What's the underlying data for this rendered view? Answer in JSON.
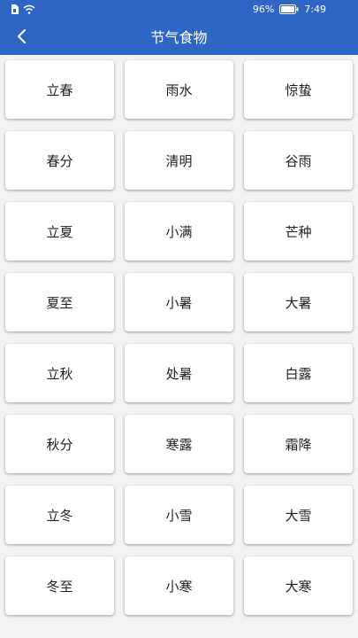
{
  "status_bar": {
    "battery_percent": "96%",
    "time": "7:49",
    "icons": [
      "sim-icon",
      "wifi-icon",
      "battery-icon"
    ]
  },
  "header": {
    "title": "节气食物",
    "back_icon": "chevron-left-icon"
  },
  "colors": {
    "primary": "#2f66c6",
    "background": "#f2f2f2",
    "tile": "#ffffff",
    "text": "#222222"
  },
  "solar_terms": [
    "立春",
    "雨水",
    "惊蛰",
    "春分",
    "清明",
    "谷雨",
    "立夏",
    "小满",
    "芒种",
    "夏至",
    "小暑",
    "大暑",
    "立秋",
    "处暑",
    "白露",
    "秋分",
    "寒露",
    "霜降",
    "立冬",
    "小雪",
    "大雪",
    "冬至",
    "小寒",
    "大寒"
  ]
}
